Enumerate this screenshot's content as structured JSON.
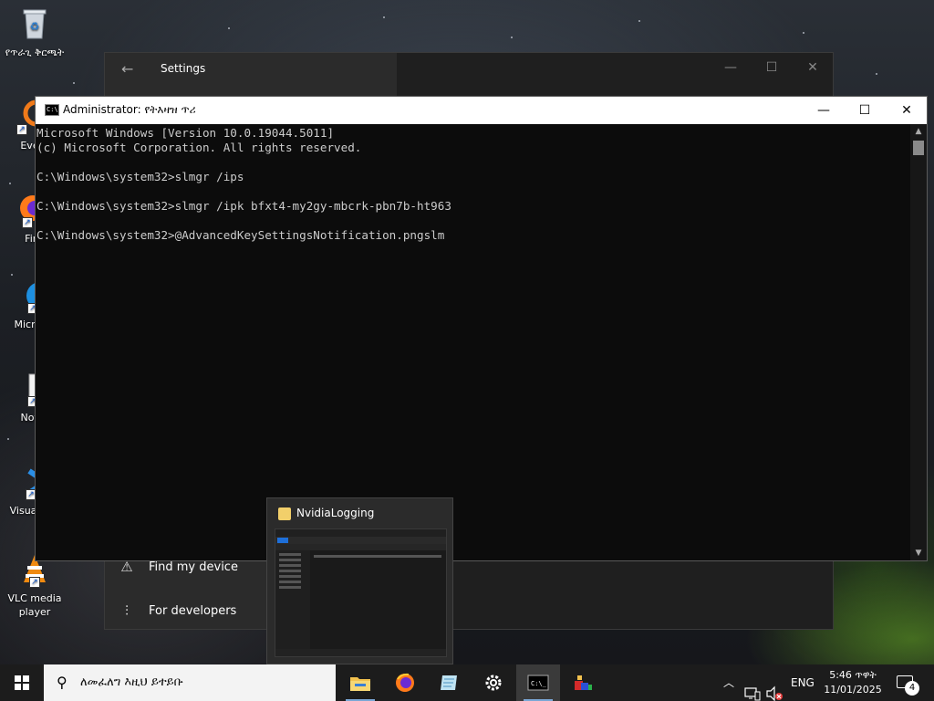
{
  "desktop": {
    "icons": [
      {
        "label": "የጥራጊ ቅርጫት",
        "icon": "recycle-bin-icon"
      },
      {
        "label": "Every",
        "icon": "everything-search-icon"
      },
      {
        "label": "Fire",
        "icon": "firefox-icon"
      },
      {
        "label": "Micro Ed",
        "icon": "edge-icon"
      },
      {
        "label": "Notep",
        "icon": "notepad-plus-icon"
      },
      {
        "label": "Visual Co",
        "icon": "vscode-icon"
      },
      {
        "label": "VLC media player",
        "icon": "vlc-icon"
      }
    ]
  },
  "settings_window": {
    "title": "Settings",
    "menu": [
      {
        "label": "Find my device",
        "icon": "find-device-icon"
      },
      {
        "label": "For developers",
        "icon": "developer-tools-icon"
      }
    ]
  },
  "cmd_window": {
    "title": "Administrator: የትእዛዝ ጥሪ",
    "lines": [
      "Microsoft Windows [Version 10.0.19044.5011]",
      "(c) Microsoft Corporation. All rights reserved.",
      "",
      "C:\\Windows\\system32>slmgr /ips",
      "",
      "C:\\Windows\\system32>slmgr /ipk bfxt4-my2gy-mbcrk-pbn7b-ht963",
      "",
      "C:\\Windows\\system32>@AdvancedKeySettingsNotification.pngslm"
    ]
  },
  "taskbar_preview": {
    "title": "NvidiaLogging"
  },
  "taskbar": {
    "search_placeholder": "ለመፈለግ እዚህ ይተይቡ",
    "apps": [
      {
        "name": "file-explorer",
        "icon": "folder-icon"
      },
      {
        "name": "firefox",
        "icon": "firefox-icon"
      },
      {
        "name": "notepad",
        "icon": "notepad-icon"
      },
      {
        "name": "settings",
        "icon": "gear-icon"
      },
      {
        "name": "command-prompt",
        "icon": "cmd-icon"
      },
      {
        "name": "app-bundle",
        "icon": "app-bundle-icon"
      }
    ],
    "language": "ENG",
    "time": "5:46 ጥዋት",
    "date": "11/01/2025",
    "notification_count": "4"
  }
}
